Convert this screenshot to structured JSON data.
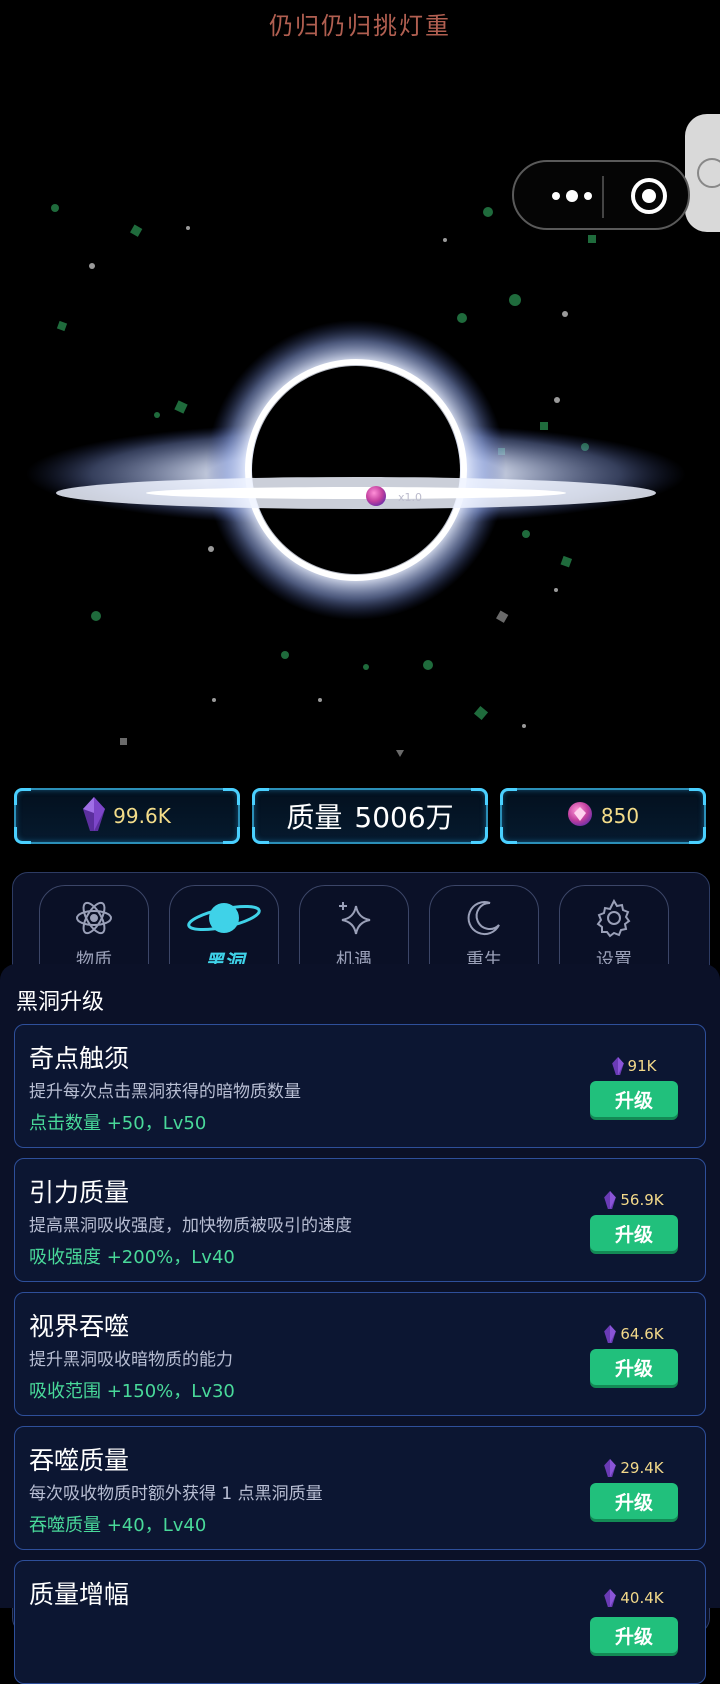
{
  "header": {
    "title": "仍归仍归挑灯重"
  },
  "stats": {
    "dark_matter": "99.6K",
    "mass_label": "质量",
    "mass_value": "5006万",
    "gems": "850"
  },
  "scene": {
    "orbit_text": "x1.0"
  },
  "tabs": [
    {
      "label": "物质",
      "icon": "atom-icon",
      "active": false
    },
    {
      "label": "黑洞",
      "icon": "planet-ring-icon",
      "active": true
    },
    {
      "label": "机遇",
      "icon": "sparkle-icon",
      "active": false
    },
    {
      "label": "重生",
      "icon": "moon-icon",
      "active": false
    },
    {
      "label": "设置",
      "icon": "gear-icon",
      "active": false
    }
  ],
  "section_title": "黑洞升级",
  "upgrades": [
    {
      "name": "奇点触须",
      "desc": "提升每次点击黑洞获得的暗物质数量",
      "effect": "点击数量 +50，Lv50",
      "cost": "91K",
      "button": "升级"
    },
    {
      "name": "引力质量",
      "desc": "提高黑洞吸收强度，加快物质被吸引的速度",
      "effect": "吸收强度 +200%，Lv40",
      "cost": "56.9K",
      "button": "升级"
    },
    {
      "name": "视界吞噬",
      "desc": "提升黑洞吸收暗物质的能力",
      "effect": "吸收范围 +150%，Lv30",
      "cost": "64.6K",
      "button": "升级"
    },
    {
      "name": "吞噬质量",
      "desc": "每次吸收物质时额外获得 1 点黑洞质量",
      "effect": "吞噬质量 +40，Lv40",
      "cost": "29.4K",
      "button": "升级"
    },
    {
      "name": "质量增幅",
      "desc": "",
      "effect": "",
      "cost": "40.4K",
      "button": "升级"
    }
  ],
  "colors": {
    "accent": "#3fd2e8",
    "button": "#21c07c",
    "effect_text": "#49d99a",
    "cost_text": "#f3d98a",
    "card_border": "#2e4f9a"
  }
}
